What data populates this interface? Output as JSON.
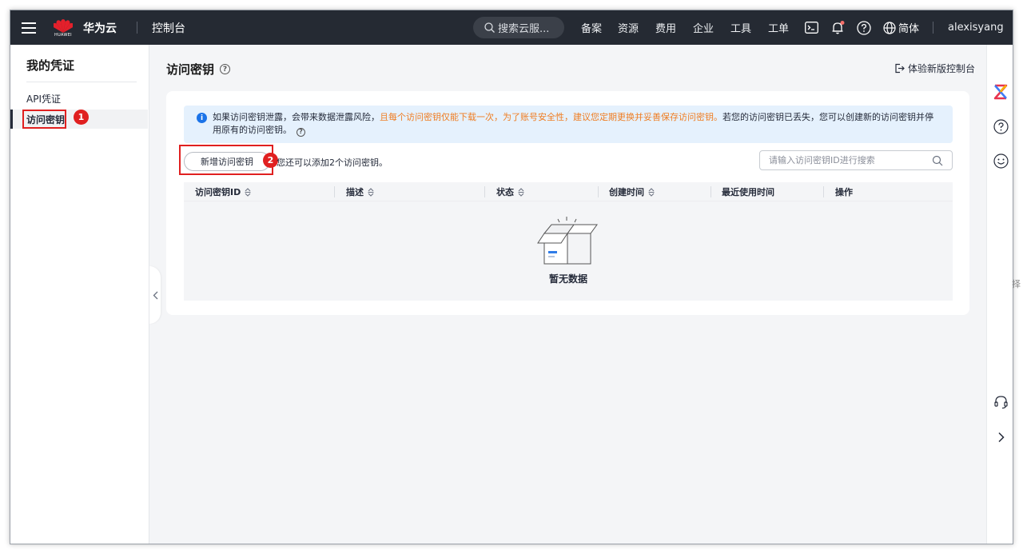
{
  "topbar": {
    "brand_name": "华为云",
    "logo_text": "HUAWEI",
    "console_label": "控制台",
    "search_label": "搜索云服...",
    "nav_items": [
      "备案",
      "资源",
      "费用",
      "企业",
      "工具",
      "工单"
    ],
    "language_label": "简体",
    "username": "alexisyang"
  },
  "sidebar": {
    "title": "我的凭证",
    "items": [
      {
        "label": "API凭证",
        "active": false
      },
      {
        "label": "访问密钥",
        "active": true
      }
    ],
    "step_badge": "1"
  },
  "main": {
    "page_title": "访问密钥",
    "new_console_label": "体验新版控制台",
    "info": {
      "text_part1": "如果访问密钥泄露，会带来数据泄露风险，",
      "text_warning": "且每个访问密钥仅能下载一次，为了账号安全性，建议您定期更换并妥善保存访问密钥。",
      "text_part2": "若您的访问密钥已丢失，您可以创建新的访问密钥并停用原有的访问密钥。"
    },
    "add_button_label": "新增访问密钥",
    "add_step_badge": "2",
    "remaining_text": "您还可以添加2个访问密钥。",
    "search_placeholder": "请输入访问密钥ID进行搜索",
    "table": {
      "columns": [
        {
          "label": "访问密钥ID",
          "sortable": true
        },
        {
          "label": "描述",
          "sortable": true
        },
        {
          "label": "状态",
          "sortable": true
        },
        {
          "label": "创建时间",
          "sortable": true
        },
        {
          "label": "最近使用时间",
          "sortable": false
        },
        {
          "label": "操作",
          "sortable": false
        }
      ],
      "empty_text": "暂无数据"
    }
  },
  "edge_text": "择",
  "colors": {
    "topbar_bg": "#252a33",
    "highlight_red": "#e02020",
    "info_bg": "#e5f1fd",
    "warning_orange": "#ef7d22",
    "info_blue": "#1b73e8"
  },
  "icons": [
    "menu-icon",
    "huawei-logo",
    "search-icon",
    "terminal-icon",
    "bell-icon",
    "help-icon",
    "globe-icon",
    "collapse-icon",
    "exit-icon",
    "info-icon",
    "sort-icon",
    "empty-box-icon",
    "ai-assistant-icon",
    "smile-icon",
    "headset-icon",
    "chevron-right-icon"
  ]
}
